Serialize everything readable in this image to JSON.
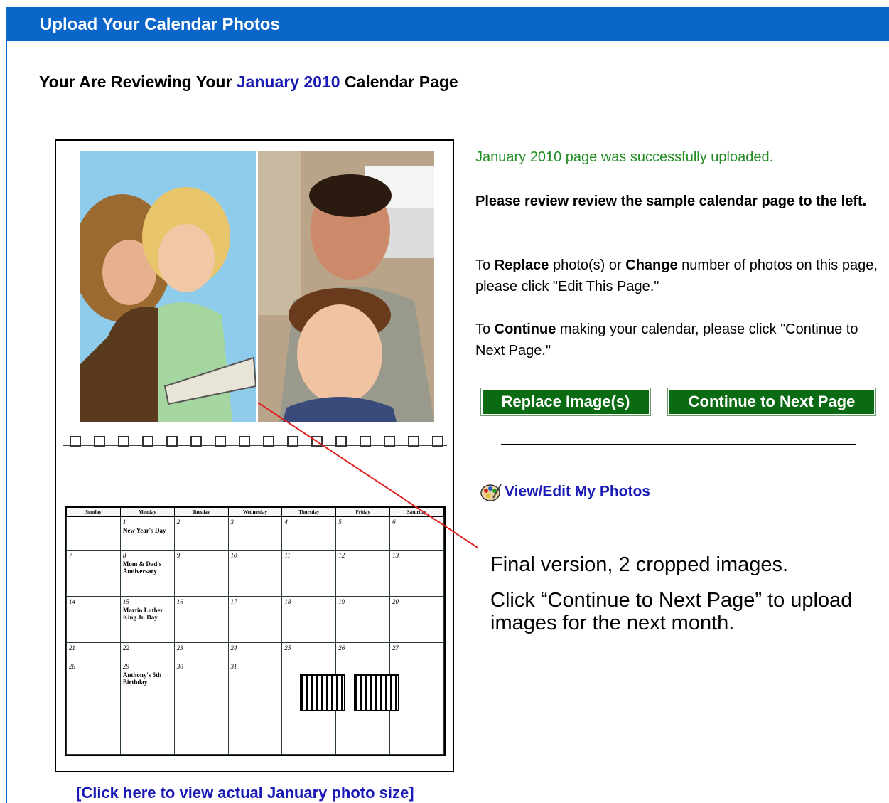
{
  "header": {
    "title": "Upload Your Calendar Photos"
  },
  "review": {
    "prefix": "Your Are Reviewing Your",
    "month": "January 2010",
    "suffix": "Calendar Page"
  },
  "calendar": {
    "weekdays": [
      "Sunday",
      "Monday",
      "Tuesday",
      "Wednesday",
      "Thursday",
      "Friday",
      "Saturday"
    ],
    "weeks": [
      [
        {
          "d": ""
        },
        {
          "d": "1",
          "note": "New Year's Day"
        },
        {
          "d": "2"
        },
        {
          "d": "3"
        },
        {
          "d": "4"
        },
        {
          "d": "5"
        },
        {
          "d": "6"
        }
      ],
      [
        {
          "d": "7"
        },
        {
          "d": "8",
          "note": "Mom & Dad's Anniversary"
        },
        {
          "d": "9"
        },
        {
          "d": "10"
        },
        {
          "d": "11"
        },
        {
          "d": "12"
        },
        {
          "d": "13"
        }
      ],
      [
        {
          "d": "14"
        },
        {
          "d": "15",
          "note": "Martin Luther King Jr. Day"
        },
        {
          "d": "16"
        },
        {
          "d": "17"
        },
        {
          "d": "18"
        },
        {
          "d": "19"
        },
        {
          "d": "20"
        }
      ],
      [
        {
          "d": "21"
        },
        {
          "d": "22"
        },
        {
          "d": "23"
        },
        {
          "d": "24"
        },
        {
          "d": "25"
        },
        {
          "d": "26"
        },
        {
          "d": "27"
        }
      ],
      [
        {
          "d": "28"
        },
        {
          "d": "29",
          "note": "Anthony's 5th Birthday"
        },
        {
          "d": "30"
        },
        {
          "d": "31"
        },
        {
          "d": "mini"
        },
        {
          "d": "mini"
        },
        {
          "d": ""
        }
      ]
    ]
  },
  "photo_size_link": "[Click here to view actual January photo size]",
  "right": {
    "success": "January 2010 page was successfully uploaded.",
    "review_prompt": "Please review review the sample calendar page to the left.",
    "replace_text": {
      "pre": "To",
      "bold1": "Replace",
      "mid": "photo(s) or",
      "bold2": "Change",
      "post": "number of photos on this page, please click \"Edit This Page.\""
    },
    "continue_text": {
      "pre": "To",
      "bold": "Continue",
      "post": "making your calendar, please click \"Continue to Next Page.\""
    },
    "replace_button": "Replace Image(s)",
    "continue_button": "Continue to Next Page",
    "view_edit_link": "View/Edit My Photos"
  },
  "annotation": {
    "line1": "Final version, 2 cropped images.",
    "line2": "Click “Continue to Next Page” to upload images for the next month."
  },
  "colors": {
    "header": "#0a66c8",
    "success": "#228b22",
    "button": "#0b6b12",
    "link": "#1a1ab4",
    "arrow": "#e02020"
  },
  "icons": [
    "palette-icon"
  ]
}
